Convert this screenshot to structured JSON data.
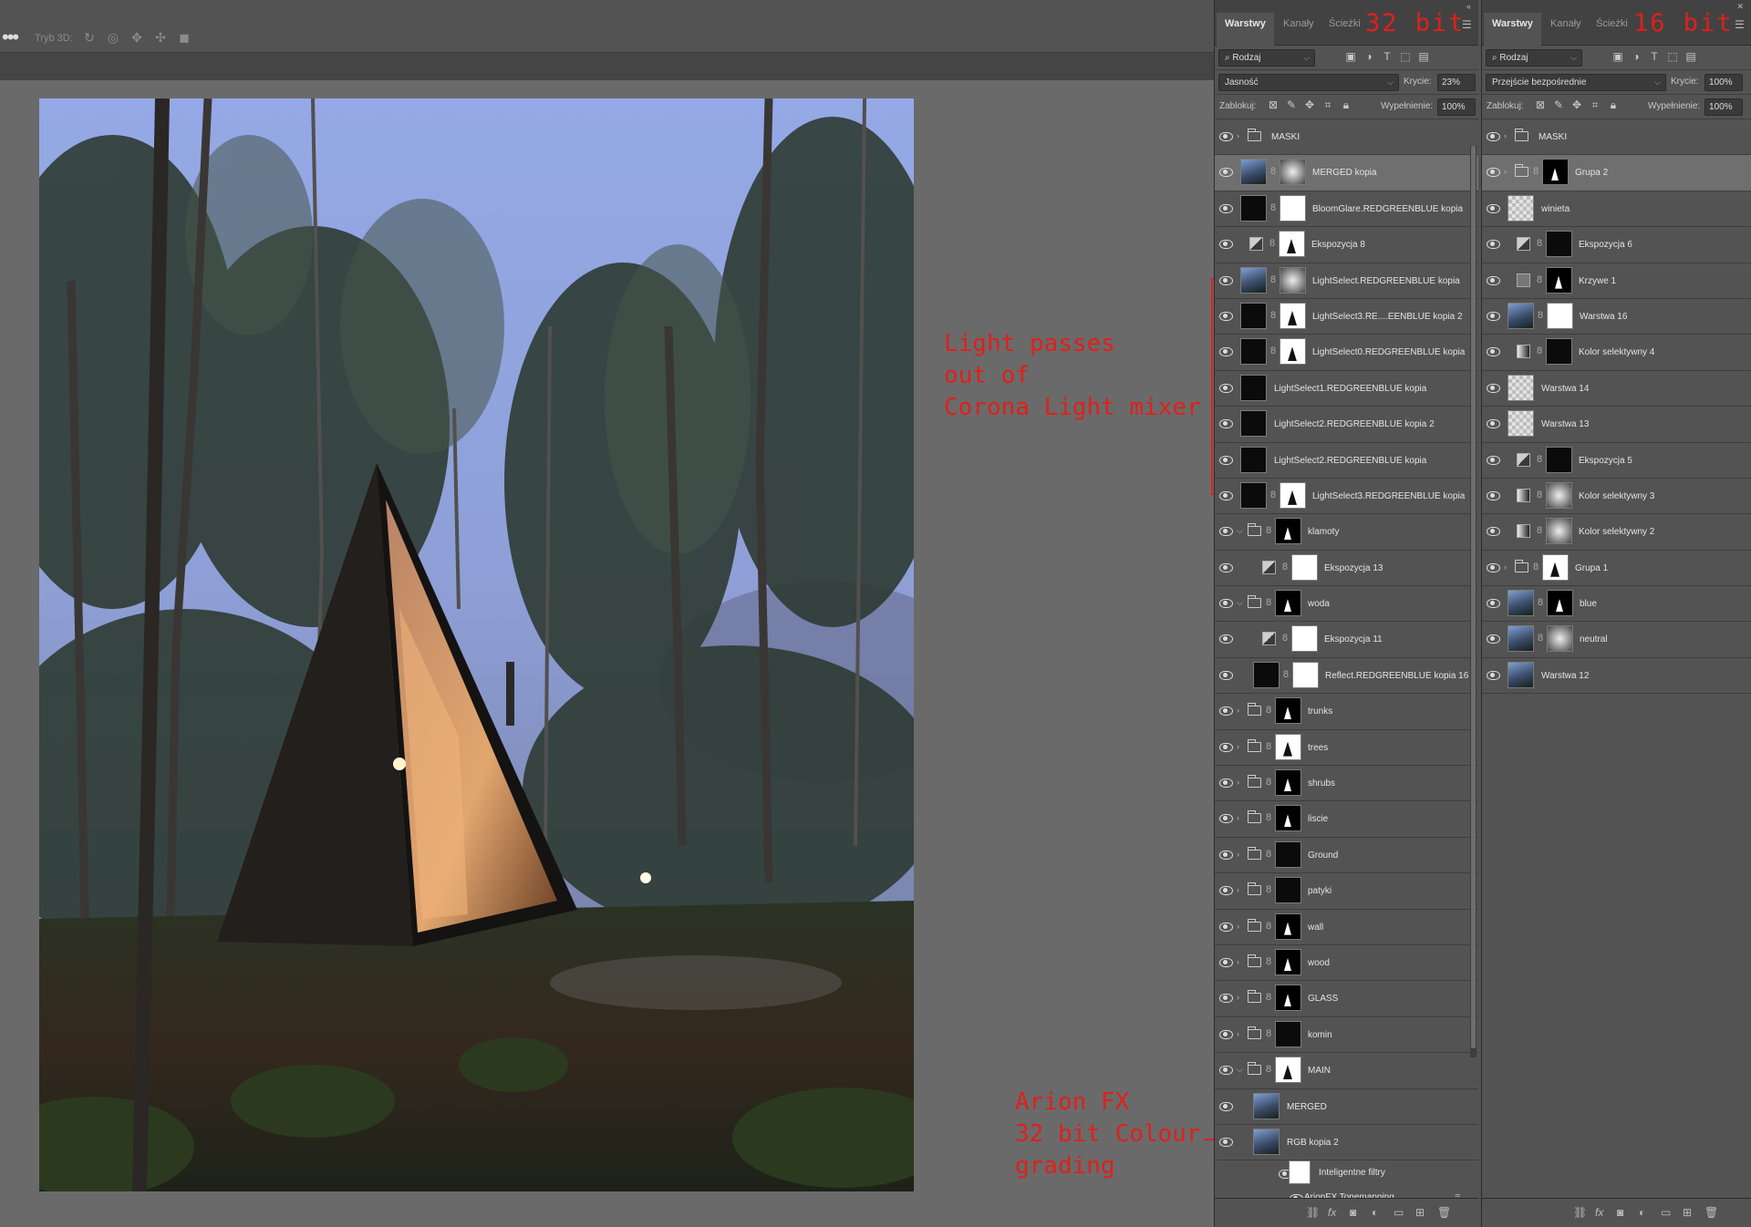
{
  "toolbar": {
    "mode_label": "Tryb 3D:"
  },
  "annotations": {
    "light_mixer": "Light passes\nout of\nCorona Light mixer",
    "arion": "Arion FX\n32 bit Colour\ngrading",
    "left_bits": "32 bit",
    "right_bits": "16 bit"
  },
  "panel_left": {
    "tabs": [
      "Warstwy",
      "Kanały",
      "Ścieżki"
    ],
    "filter": "Rodzaj",
    "blend_mode": "Jasność",
    "opacity_label": "Krycie:",
    "opacity": "23%",
    "lock_label": "Zablokuj:",
    "fill_label": "Wypełnienie:",
    "fill": "100%",
    "layers": [
      {
        "name": "MASKI",
        "kind": "group",
        "indent": 0,
        "open": false
      },
      {
        "name": "MERGED kopia",
        "kind": "img",
        "mask": "gray",
        "indent": 0,
        "hl": true
      },
      {
        "name": "BloomGlare.REDGREENBLUE kopia",
        "kind": "blk",
        "mask": "wht",
        "indent": 0
      },
      {
        "name": "Ekspozycja 8",
        "kind": "adj",
        "mask": "mw",
        "indent": 0
      },
      {
        "name": "LightSelect.REDGREENBLUE kopia",
        "kind": "img",
        "mask": "gray",
        "indent": 0
      },
      {
        "name": "LightSelect3.RE....EENBLUE kopia 2",
        "kind": "blk",
        "mask": "mw",
        "indent": 0
      },
      {
        "name": "LightSelect0.REDGREENBLUE kopia",
        "kind": "blk",
        "mask": "mw",
        "indent": 0
      },
      {
        "name": "LightSelect1.REDGREENBLUE kopia",
        "kind": "blk",
        "indent": 0
      },
      {
        "name": "LightSelect2.REDGREENBLUE kopia 2",
        "kind": "blk",
        "indent": 0
      },
      {
        "name": "LightSelect2.REDGREENBLUE kopia",
        "kind": "blk",
        "indent": 0
      },
      {
        "name": "LightSelect3.REDGREENBLUE kopia",
        "kind": "blk",
        "mask": "mw",
        "indent": 0
      },
      {
        "name": "klamoty",
        "kind": "group",
        "mask": "mask",
        "indent": 0,
        "open": true
      },
      {
        "name": "Ekspozycja 13",
        "kind": "adj",
        "mask": "wht",
        "indent": 1
      },
      {
        "name": "woda",
        "kind": "group",
        "mask": "mask",
        "indent": 0,
        "open": true
      },
      {
        "name": "Ekspozycja 11",
        "kind": "adj",
        "mask": "wht",
        "indent": 1
      },
      {
        "name": "Reflect.REDGREENBLUE kopia 16",
        "kind": "blk",
        "mask": "wht",
        "indent": 1
      },
      {
        "name": "trunks",
        "kind": "group",
        "mask": "mask",
        "indent": 0,
        "open": false
      },
      {
        "name": "trees",
        "kind": "group",
        "mask": "mw",
        "indent": 0,
        "open": false
      },
      {
        "name": "shrubs",
        "kind": "group",
        "mask": "mask",
        "indent": 0,
        "open": false
      },
      {
        "name": "liscie",
        "kind": "group",
        "mask": "mask",
        "indent": 0,
        "open": false
      },
      {
        "name": "Ground",
        "kind": "group",
        "mask": "blk",
        "indent": 0,
        "open": false
      },
      {
        "name": "patyki",
        "kind": "group",
        "mask": "blk",
        "indent": 0,
        "open": false
      },
      {
        "name": "wall",
        "kind": "group",
        "mask": "mask",
        "indent": 0,
        "open": false
      },
      {
        "name": "wood",
        "kind": "group",
        "mask": "mask",
        "indent": 0,
        "open": false
      },
      {
        "name": "GLASS",
        "kind": "group",
        "mask": "mask",
        "indent": 0,
        "open": false
      },
      {
        "name": "komin",
        "kind": "group",
        "mask": "blk",
        "indent": 0,
        "open": false
      },
      {
        "name": "MAIN",
        "kind": "group",
        "mask": "mw",
        "indent": 0,
        "open": true
      },
      {
        "name": "MERGED",
        "kind": "img",
        "indent": 1
      },
      {
        "name": "RGB kopia 2",
        "kind": "img",
        "indent": 1
      }
    ],
    "smart_filters_label": "Inteligentne filtry",
    "smart_filter_item": "ArionFX Tonemapping"
  },
  "panel_right": {
    "tabs": [
      "Warstwy",
      "Kanały",
      "Ścieżki"
    ],
    "filter": "Rodzaj",
    "blend_mode": "Przejście bezpośrednie",
    "opacity_label": "Krycie:",
    "opacity": "100%",
    "lock_label": "Zablokuj:",
    "fill_label": "Wypełnienie:",
    "fill": "100%",
    "layers": [
      {
        "name": "MASKI",
        "kind": "group",
        "open": false
      },
      {
        "name": "Grupa 2",
        "kind": "group",
        "mask": "mask",
        "open": false,
        "hl": true
      },
      {
        "name": "winieta",
        "kind": "chk"
      },
      {
        "name": "Ekspozycja 6",
        "kind": "adj",
        "mask": "blk"
      },
      {
        "name": "Krzywe 1",
        "kind": "curve",
        "mask": "mask"
      },
      {
        "name": "Warstwa 16",
        "kind": "img",
        "mask": "wht"
      },
      {
        "name": "Kolor selektywny 4",
        "kind": "sc",
        "mask": "blk"
      },
      {
        "name": "Warstwa 14",
        "kind": "chk"
      },
      {
        "name": "Warstwa 13",
        "kind": "chk"
      },
      {
        "name": "Ekspozycja 5",
        "kind": "adj",
        "mask": "blk"
      },
      {
        "name": "Kolor selektywny 3",
        "kind": "sc",
        "mask": "gray"
      },
      {
        "name": "Kolor selektywny 2",
        "kind": "sc",
        "mask": "gray"
      },
      {
        "name": "Grupa 1",
        "kind": "group",
        "mask": "mw",
        "open": false
      },
      {
        "name": "blue",
        "kind": "img",
        "mask": "mask"
      },
      {
        "name": "neutral",
        "kind": "img",
        "mask": "gray"
      },
      {
        "name": "Warstwa 12",
        "kind": "img"
      }
    ]
  }
}
